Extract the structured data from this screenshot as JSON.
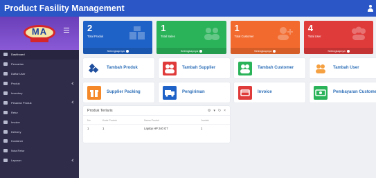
{
  "app": {
    "title": "Product Fasility Management"
  },
  "colors": {
    "topbar": "#2a56c6",
    "sidebar": "#2f2c4a",
    "blue": "#1f62c7",
    "green": "#2bb35a",
    "orange": "#f26a2e",
    "red": "#e03b3b"
  },
  "logo": {
    "text": "MA"
  },
  "sidebar": {
    "items": [
      {
        "label": "Dashboard",
        "icon": "home-icon",
        "active": true
      },
      {
        "label": "Pencarian",
        "icon": "search-icon"
      },
      {
        "label": "Daftar User",
        "icon": "users-icon"
      },
      {
        "label": "Produk",
        "icon": "box-icon",
        "caret": true
      },
      {
        "label": "Inventory",
        "icon": "inventory-icon"
      },
      {
        "label": "Pesanan Produk",
        "icon": "cart-icon",
        "caret": true
      },
      {
        "label": "Retur",
        "icon": "return-icon"
      },
      {
        "label": "Invoice",
        "icon": "invoice-icon"
      },
      {
        "label": "Delivery",
        "icon": "truck-icon"
      },
      {
        "label": "Kontainer",
        "icon": "container-icon"
      },
      {
        "label": "Nota Retur",
        "icon": "note-icon"
      },
      {
        "label": "Laporan",
        "icon": "report-icon",
        "caret": true
      }
    ]
  },
  "stats": [
    {
      "value": "2",
      "label": "Total Produk",
      "footer": "Selengkapnya",
      "color": "#1f62c7",
      "icon": "box-stack-icon"
    },
    {
      "value": "1",
      "label": "Total Sales",
      "footer": "Selengkapnya",
      "color": "#2bb35a",
      "icon": "group-icon"
    },
    {
      "value": "1",
      "label": "Total Customer",
      "footer": "Selengkapnya",
      "color": "#f26a2e",
      "icon": "user-add-icon"
    },
    {
      "value": "4",
      "label": "Total User",
      "footer": "Selengkapnya",
      "color": "#e03b3b",
      "icon": "users-icon"
    }
  ],
  "actions": [
    {
      "label": "Tambah Produk",
      "icon": "boxes-icon",
      "color": "#1f4f9e"
    },
    {
      "label": "Tambah Supplier",
      "icon": "supplier-icon",
      "color": "#e03b3b"
    },
    {
      "label": "Tambah Customer",
      "icon": "customer-icon",
      "color": "#2bb35a"
    },
    {
      "label": "Tambah User",
      "icon": "user-plus-icon",
      "color": "#f5a142"
    },
    {
      "label": "Supplier Packing",
      "icon": "gift-icon",
      "color": "#f5892a"
    },
    {
      "label": "Pengiriman",
      "icon": "truck-icon",
      "color": "#1f62c7"
    },
    {
      "label": "Invoice",
      "icon": "card-icon",
      "color": "#e03b3b"
    },
    {
      "label": "Pembayaran Customer",
      "icon": "money-icon",
      "color": "#2bb35a"
    }
  ],
  "panel": {
    "title": "Produk Terlaris",
    "columns": [
      "No",
      "Kode Produk",
      "Nama Produk",
      "Jumlah"
    ],
    "rows": [
      [
        "1",
        "1",
        "Laptop HP 240 G7",
        "1"
      ]
    ]
  }
}
